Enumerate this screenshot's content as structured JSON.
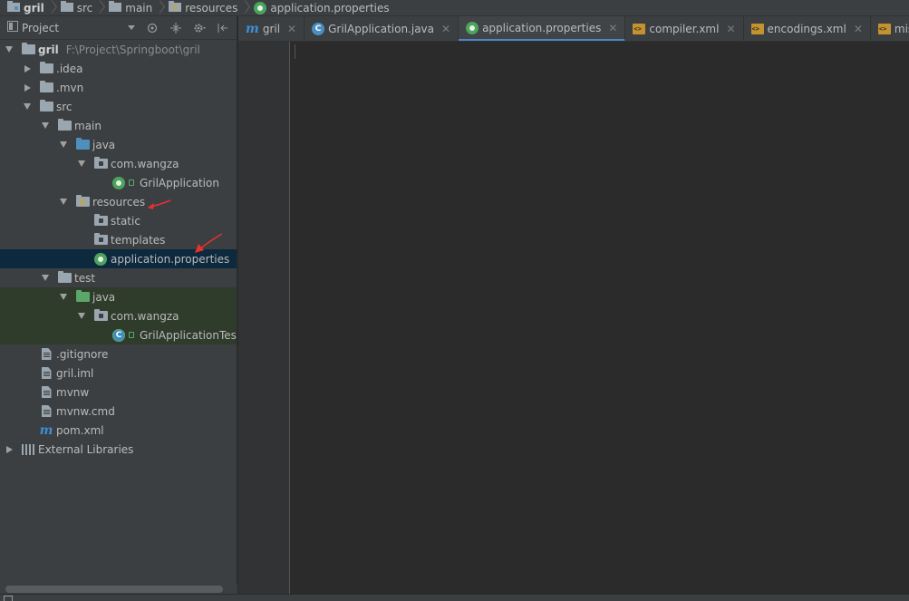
{
  "breadcrumb": [
    {
      "label": "gril",
      "icon": "module-folder-icon"
    },
    {
      "label": "src",
      "icon": "folder-icon"
    },
    {
      "label": "main",
      "icon": "folder-icon"
    },
    {
      "label": "resources",
      "icon": "resources-folder-icon"
    },
    {
      "label": "application.properties",
      "icon": "spring-properties-icon"
    }
  ],
  "project_panel": {
    "title": "Project",
    "tree": [
      {
        "label": "gril",
        "path": "F:\\Project\\Springboot\\gril"
      },
      {
        "label": ".idea"
      },
      {
        "label": ".mvn"
      },
      {
        "label": "src"
      },
      {
        "label": "main"
      },
      {
        "label": "java"
      },
      {
        "label": "com.wangza"
      },
      {
        "label": "GrilApplication"
      },
      {
        "label": "resources"
      },
      {
        "label": "static"
      },
      {
        "label": "templates"
      },
      {
        "label": "application.properties"
      },
      {
        "label": "test"
      },
      {
        "label": "java"
      },
      {
        "label": "com.wangza"
      },
      {
        "label": "GrilApplicationTes"
      },
      {
        "label": ".gitignore"
      },
      {
        "label": "gril.iml"
      },
      {
        "label": "mvnw"
      },
      {
        "label": "mvnw.cmd"
      },
      {
        "label": "pom.xml"
      },
      {
        "label": "External Libraries"
      }
    ]
  },
  "tabs": [
    {
      "label": "gril",
      "icon": "maven-m-icon"
    },
    {
      "label": "GrilApplication.java",
      "icon": "java-class-icon"
    },
    {
      "label": "application.properties",
      "icon": "spring-properties-icon",
      "active": true
    },
    {
      "label": "compiler.xml",
      "icon": "xml-icon"
    },
    {
      "label": "encodings.xml",
      "icon": "xml-icon"
    },
    {
      "label": "misc.xml",
      "icon": "xml-icon"
    }
  ],
  "colors": {
    "accent": "#4a88c7",
    "selection": "#0d293e",
    "annotation_arrow": "#e8312f"
  }
}
